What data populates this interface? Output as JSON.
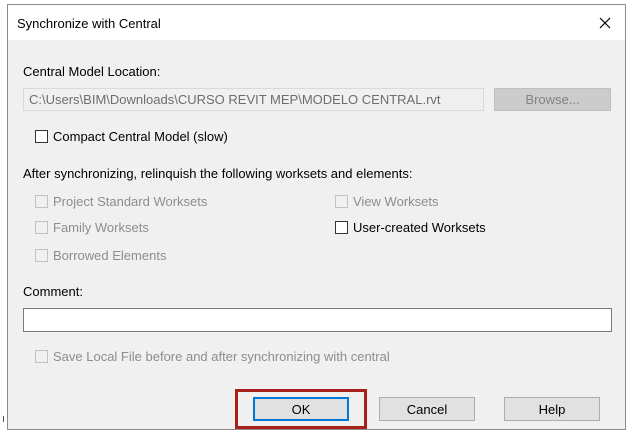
{
  "dialog": {
    "title": "Synchronize with Central",
    "close_icon": "close-icon"
  },
  "central_model": {
    "label": "Central Model Location:",
    "path": "C:\\Users\\BIM\\Downloads\\CURSO REVIT MEP\\MODELO CENTRAL.rvt",
    "browse_label": "Browse..."
  },
  "compact": {
    "label": "Compact Central Model (slow)",
    "checked": false
  },
  "relinquish": {
    "heading": "After synchronizing, relinquish the following worksets and elements:",
    "options": [
      {
        "label": "Project Standard Worksets",
        "enabled": false,
        "checked": false
      },
      {
        "label": "View Worksets",
        "enabled": false,
        "checked": false
      },
      {
        "label": "Family Worksets",
        "enabled": false,
        "checked": false
      },
      {
        "label": "User-created Worksets",
        "enabled": true,
        "checked": false
      },
      {
        "label": "Borrowed Elements",
        "enabled": false,
        "checked": false
      }
    ]
  },
  "comment": {
    "label": "Comment:",
    "value": ""
  },
  "save_local": {
    "label": "Save Local File before and after synchronizing with central",
    "enabled": false,
    "checked": false
  },
  "buttons": {
    "ok": "OK",
    "cancel": "Cancel",
    "help": "Help"
  },
  "colors": {
    "highlight": "#a8201a",
    "default_button_border": "#0078d7"
  }
}
